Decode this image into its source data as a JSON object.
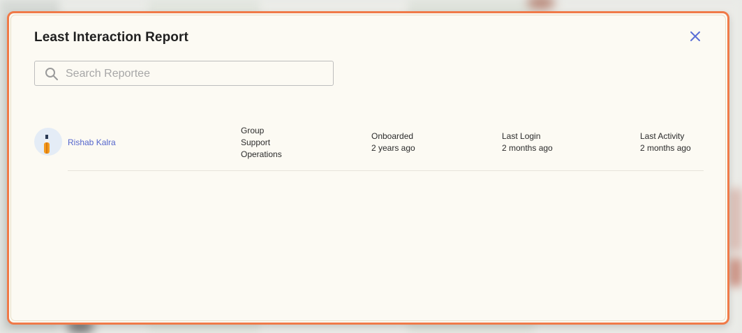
{
  "modal": {
    "title": "Least Interaction Report",
    "close_icon": "close-icon",
    "accent_color": "#f07a48",
    "link_color": "#5566cc"
  },
  "search": {
    "icon": "search-icon",
    "placeholder": "Search Reportee",
    "value": ""
  },
  "reportees": [
    {
      "name": "Rishab Kalra",
      "avatar_icon": "avatar",
      "group": [
        "Group",
        "Support",
        "Operations"
      ],
      "onboarded_label": "Onboarded",
      "onboarded_value": "2 years ago",
      "last_login_label": "Last Login",
      "last_login_value": "2 months ago",
      "last_activity_label": "Last Activity",
      "last_activity_value": "2 months ago"
    }
  ]
}
